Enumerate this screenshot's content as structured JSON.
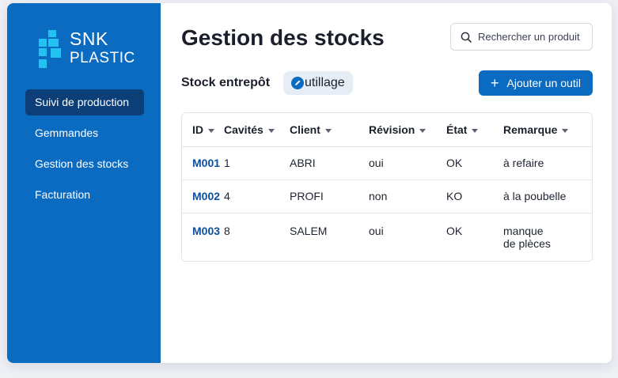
{
  "brand": {
    "line1": "SNK",
    "line2": "PLASTIC",
    "accent": "#22c3f1",
    "primary": "#0a6bc1"
  },
  "sidebar": {
    "items": [
      {
        "label": "Suivi de production",
        "active": true
      },
      {
        "label": "Gemmandes",
        "active": false
      },
      {
        "label": "Gestion des stocks",
        "active": false
      },
      {
        "label": "Facturation",
        "active": false
      }
    ]
  },
  "header": {
    "title": "Gestion des stocks",
    "search_placeholder": "Rechercher un produit",
    "search_icon": "search-icon"
  },
  "toolbar": {
    "stock_label": "Stock entrepôt",
    "chip_label": "utillage",
    "chip_icon": "edit-icon",
    "add_button_label": "Ajouter un outil",
    "add_icon": "plus-icon"
  },
  "table": {
    "columns": [
      "ID",
      "Cavités",
      "Client",
      "Révision",
      "État",
      "Remarque"
    ],
    "rows": [
      {
        "id": "M001",
        "cavites": "1",
        "client": "ABRI",
        "revision": "oui",
        "etat": "OK",
        "remarque": "à refaire",
        "remarque2": ""
      },
      {
        "id": "M002",
        "cavites": "4",
        "client": "PROFI",
        "revision": "non",
        "etat": "KO",
        "remarque": "à la poubelle",
        "remarque2": ""
      },
      {
        "id": "M003",
        "cavites": "8",
        "client": "SALEM",
        "revision": "oui",
        "etat": "OK",
        "remarque": "manque",
        "remarque2": "de plèces"
      }
    ]
  }
}
